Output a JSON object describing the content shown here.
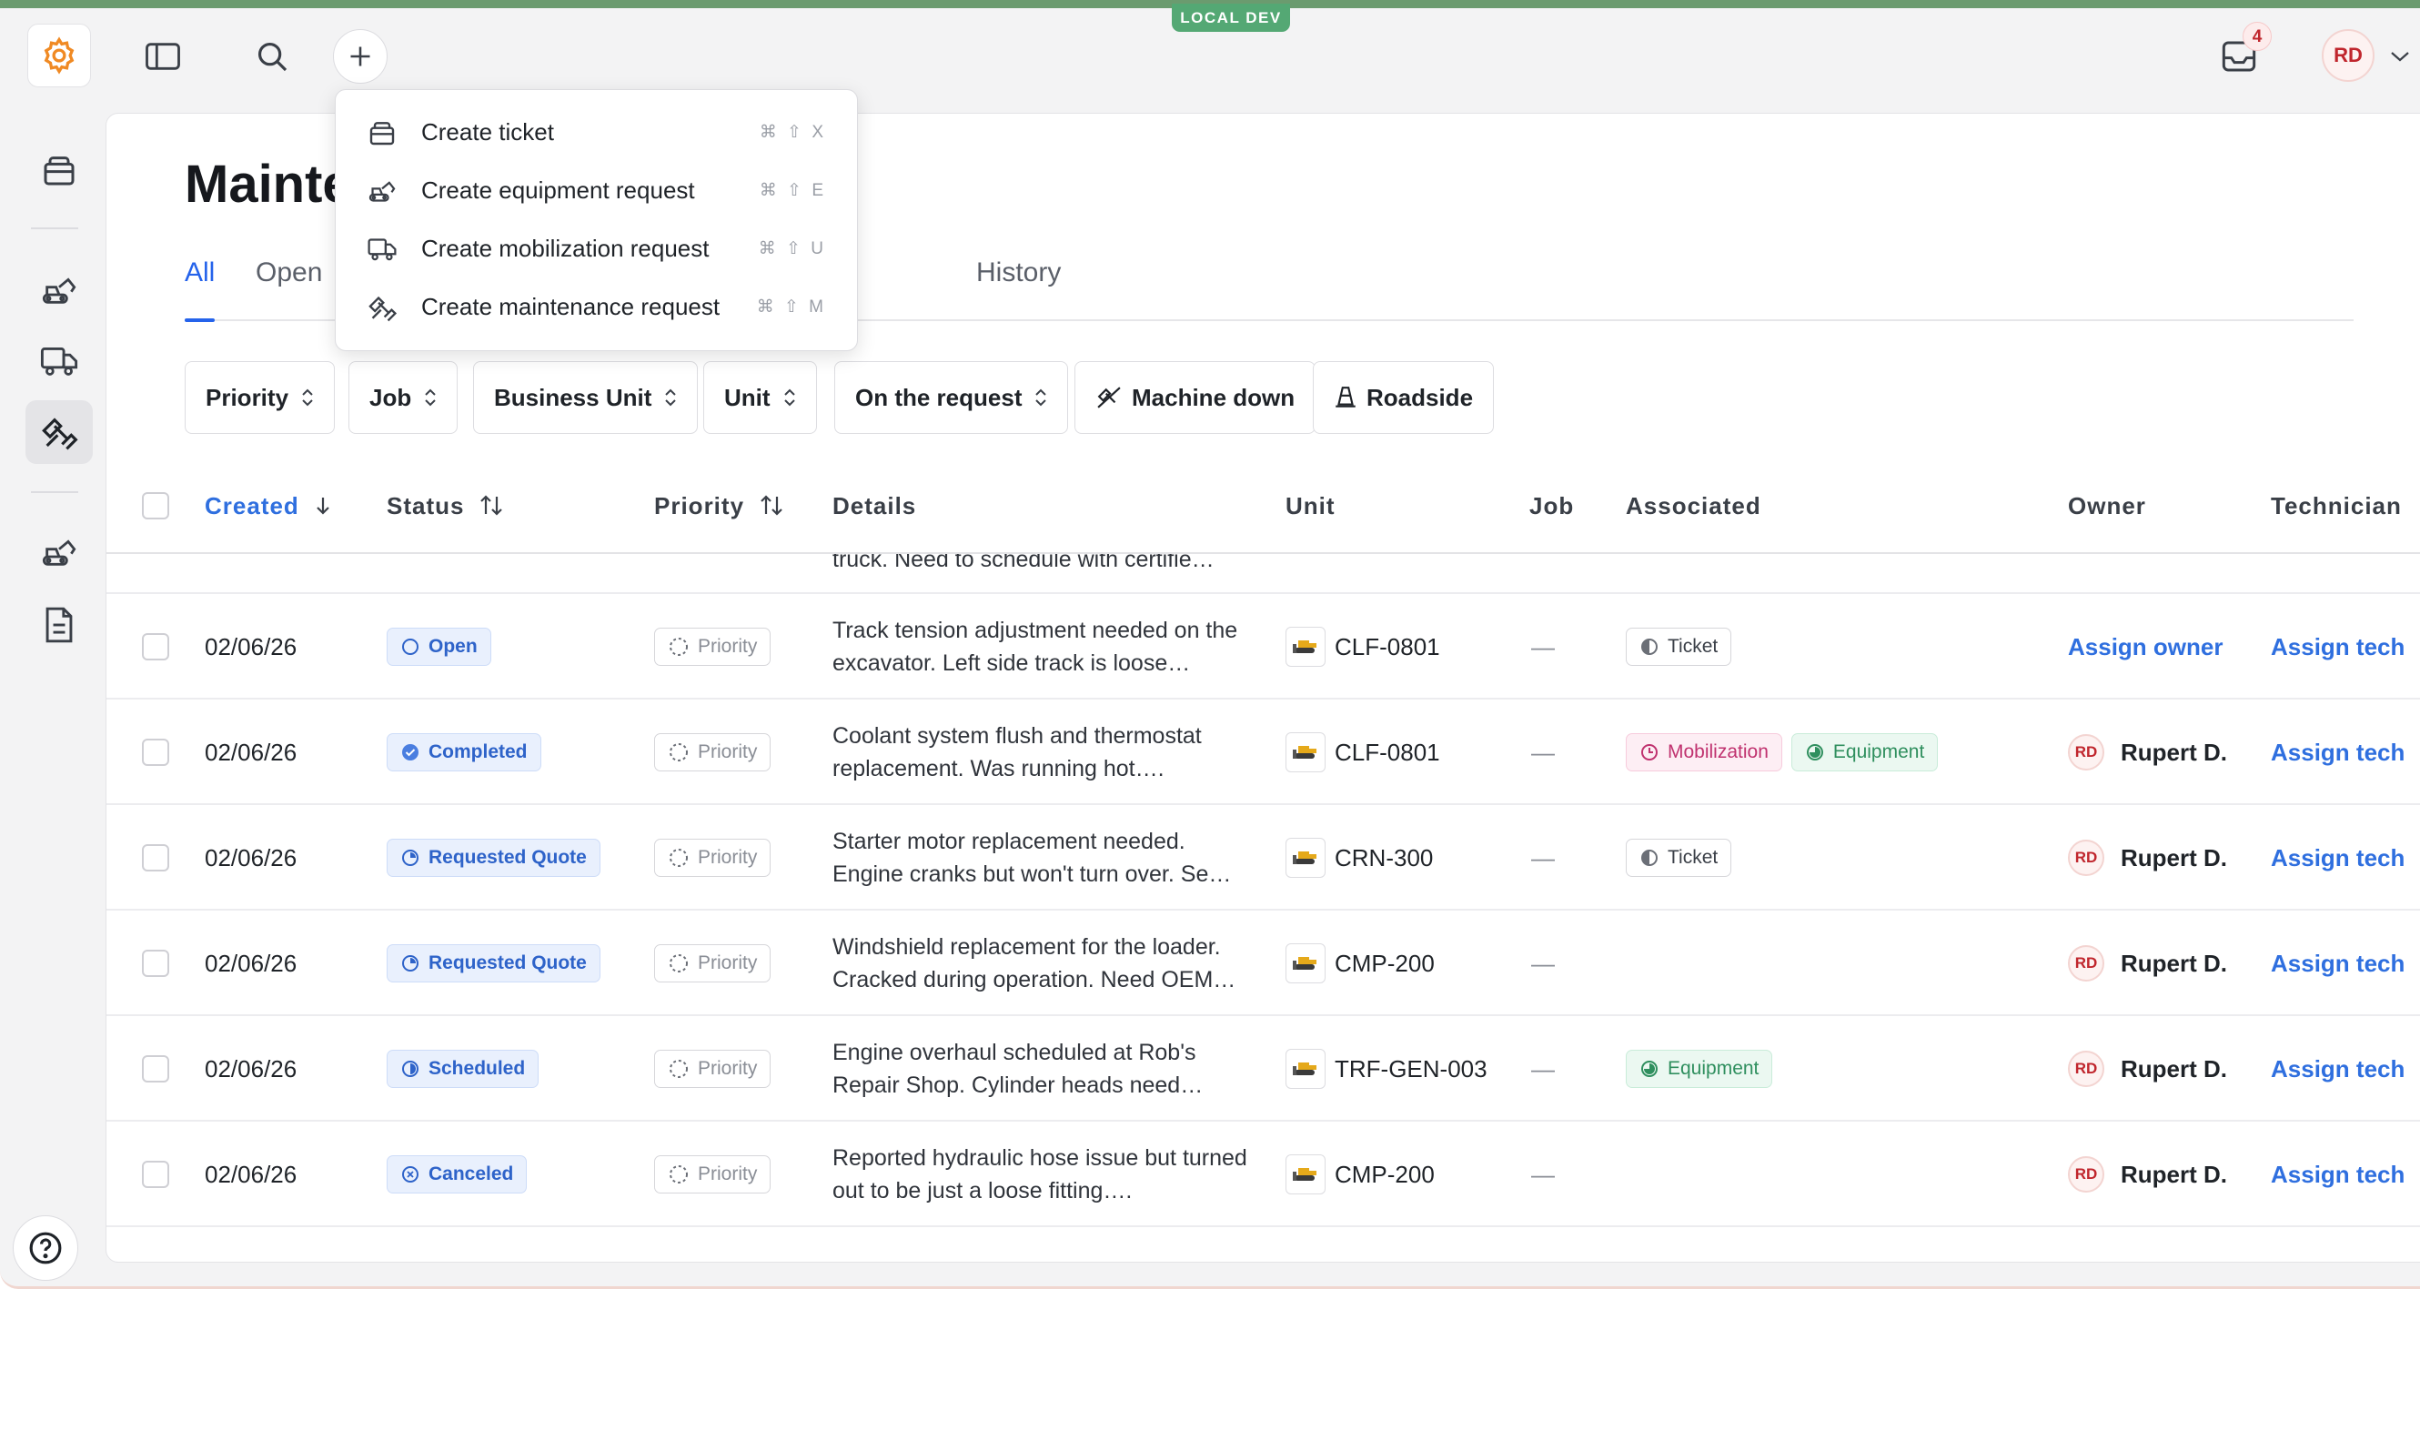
{
  "env_badge": "LOCAL DEV",
  "header": {
    "inbox_count": "4",
    "user_initials": "RD"
  },
  "page": {
    "title": "Maintenance",
    "tabs": [
      "All",
      "Open",
      "History"
    ]
  },
  "create_menu": {
    "items": [
      {
        "label": "Create ticket",
        "shortcut": "⌘ ⇧ X",
        "icon": "ticket-icon"
      },
      {
        "label": "Create equipment request",
        "shortcut": "⌘ ⇧ E",
        "icon": "excavator-icon"
      },
      {
        "label": "Create mobilization request",
        "shortcut": "⌘ ⇧ U",
        "icon": "truck-icon"
      },
      {
        "label": "Create maintenance request",
        "shortcut": "⌘ ⇧ M",
        "icon": "wrench-icon"
      }
    ]
  },
  "filters": [
    {
      "label": "Priority"
    },
    {
      "label": "Job"
    },
    {
      "label": "Business Unit"
    },
    {
      "label": "Unit"
    },
    {
      "label": "On the request"
    },
    {
      "label": "Machine down"
    },
    {
      "label": "Roadside"
    }
  ],
  "table": {
    "columns": [
      "Created",
      "Status",
      "Priority",
      "Details",
      "Unit",
      "Job",
      "Associated",
      "Owner",
      "Technician"
    ],
    "partial_top_text": "truck. Need to schedule with certifie…",
    "rows": [
      {
        "created": "02/06/26",
        "status": "Open",
        "priority": "Priority",
        "details": "Track tension adjustment needed on the excavator. Left side track is loose…",
        "unit": "CLF-0801",
        "job": "—",
        "associated": [
          "Ticket"
        ],
        "owner": "Assign owner",
        "owner_initials": "",
        "technician": "Assign tech"
      },
      {
        "created": "02/06/26",
        "status": "Completed",
        "priority": "Priority",
        "details": "Coolant system flush and thermostat replacement. Was running hot….",
        "unit": "CLF-0801",
        "job": "—",
        "associated": [
          "Mobilization",
          "Equipment"
        ],
        "owner": "Rupert D.",
        "owner_initials": "RD",
        "technician": "Assign tech"
      },
      {
        "created": "02/06/26",
        "status": "Requested Quote",
        "priority": "Priority",
        "details": "Starter motor replacement needed. Engine cranks but won't turn over. Se…",
        "unit": "CRN-300",
        "job": "—",
        "associated": [
          "Ticket"
        ],
        "owner": "Rupert D.",
        "owner_initials": "RD",
        "technician": "Assign tech"
      },
      {
        "created": "02/06/26",
        "status": "Requested Quote",
        "priority": "Priority",
        "details": "Windshield replacement for the loader. Cracked during operation. Need OEM…",
        "unit": "CMP-200",
        "job": "—",
        "associated": [],
        "owner": "Rupert D.",
        "owner_initials": "RD",
        "technician": "Assign tech"
      },
      {
        "created": "02/06/26",
        "status": "Scheduled",
        "priority": "Priority",
        "details": "Engine overhaul scheduled at Rob's Repair Shop. Cylinder heads need…",
        "unit": "TRF-GEN-003",
        "job": "—",
        "associated": [
          "Equipment"
        ],
        "owner": "Rupert D.",
        "owner_initials": "RD",
        "technician": "Assign tech"
      },
      {
        "created": "02/06/26",
        "status": "Canceled",
        "priority": "Priority",
        "details": "Reported hydraulic hose issue but turned out to be just a loose fitting….",
        "unit": "CMP-200",
        "job": "—",
        "associated": [],
        "owner": "Rupert D.",
        "owner_initials": "RD",
        "technician": "Assign tech"
      }
    ]
  },
  "colors": {
    "accent": "#2563eb",
    "env_badge": "#54a874",
    "user_red": "#c0262d"
  }
}
